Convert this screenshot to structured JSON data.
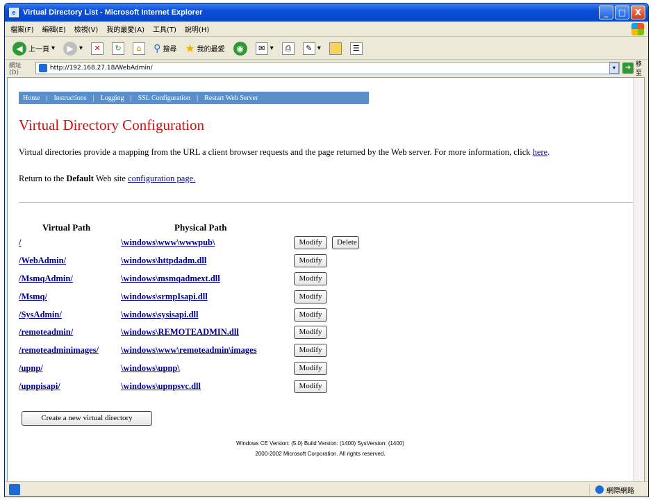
{
  "window": {
    "title": "Virtual Directory List - Microsoft Internet Explorer",
    "buttons": {
      "minimize": "_",
      "maximize": "□",
      "close": "X"
    }
  },
  "menubar": [
    "檔案(F)",
    "編輯(E)",
    "檢視(V)",
    "我的最愛(A)",
    "工具(T)",
    "說明(H)"
  ],
  "toolbar": {
    "back_label": "上一頁",
    "search_label": "搜尋",
    "favorites_label": "我的最愛"
  },
  "address": {
    "label": "網址(D)",
    "url": "http://192.168.27.18/WebAdmin/",
    "go_label": "移至"
  },
  "nav": [
    "Home",
    "Instructions",
    "Logging",
    "SSL Configuration",
    "Restart Web Server"
  ],
  "page": {
    "title": "Virtual Directory Configuration",
    "intro": "Virtual directories provide a mapping from the URL a client browser requests and the page returned by the Web server. For more information, click ",
    "intro_link": "here",
    "intro_end": ".",
    "return_prefix": "Return to the ",
    "return_bold": "Default",
    "return_mid": " Web site ",
    "return_link": "configuration page."
  },
  "table": {
    "headers": {
      "virtual": "Virtual Path",
      "physical": "Physical Path"
    },
    "modify_label": "Modify",
    "delete_label": "Delete",
    "rows": [
      {
        "virtual": "/",
        "physical": "\\windows\\www\\wwwpub\\"
      },
      {
        "virtual": "/WebAdmin/",
        "physical": "\\windows\\httpdadm.dll"
      },
      {
        "virtual": "/MsmqAdmin/",
        "physical": "\\windows\\msmqadmext.dll"
      },
      {
        "virtual": "/Msmq/",
        "physical": "\\windows\\srmpIsapi.dll"
      },
      {
        "virtual": "/SysAdmin/",
        "physical": "\\windows\\sysisapi.dll"
      },
      {
        "virtual": "/remoteadmin/",
        "physical": "\\windows\\REMOTEADMIN.dll"
      },
      {
        "virtual": "/remoteadminimages/",
        "physical": "\\windows\\www\\remoteadmin\\images"
      },
      {
        "virtual": "/upnp/",
        "physical": "\\windows\\upnp\\"
      },
      {
        "virtual": "/upnpisapi/",
        "physical": "\\windows\\upnpsvc.dll"
      }
    ]
  },
  "create_button": "Create a new virtual directory",
  "footer": {
    "line1": "Windows CE Version: (5.0) Build Version: (1400) SysVersion: (1400)",
    "line2": "2000-2002 Microsoft Corporation. All rights reserved."
  },
  "status": {
    "zone": "網際網路"
  }
}
